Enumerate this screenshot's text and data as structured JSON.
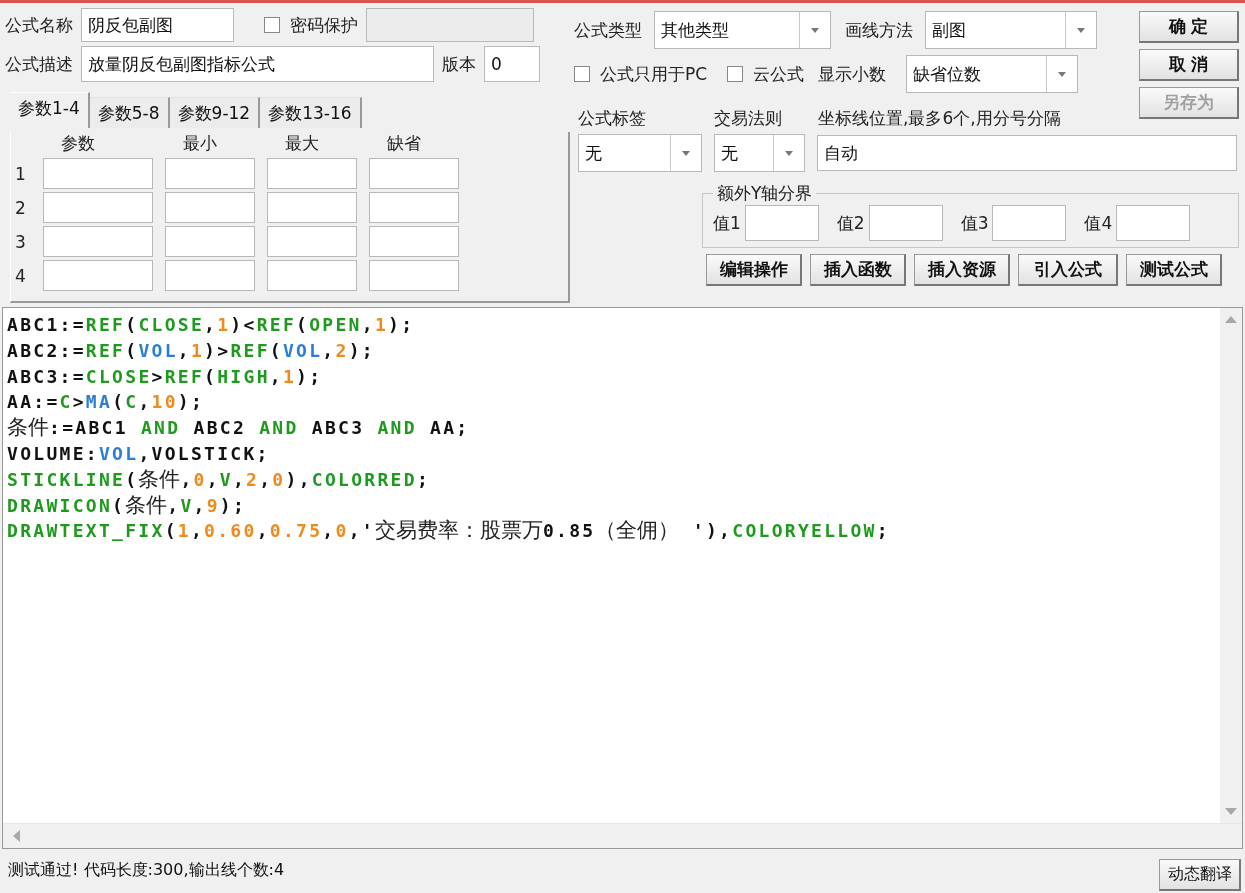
{
  "name_field": {
    "label": "公式名称",
    "value": "阴反包副图"
  },
  "password": {
    "label": "密码保护",
    "checked": false
  },
  "desc_field": {
    "label": "公式描述",
    "value": "放量阴反包副图指标公式"
  },
  "version_field": {
    "label": "版本",
    "value": "0"
  },
  "param_tabs": [
    {
      "label": "参数1-4",
      "selected": true
    },
    {
      "label": "参数5-8",
      "selected": false
    },
    {
      "label": "参数9-12",
      "selected": false
    },
    {
      "label": "参数13-16",
      "selected": false
    }
  ],
  "param_columns": [
    "参数",
    "最小",
    "最大",
    "缺省"
  ],
  "param_rows": [
    "1",
    "2",
    "3",
    "4"
  ],
  "formula_type": {
    "label": "公式类型",
    "value": "其他类型"
  },
  "draw_method": {
    "label": "画线方法",
    "value": "副图"
  },
  "options": [
    {
      "label": "公式只用于PC",
      "checked": false
    },
    {
      "label": "云公式",
      "checked": false
    }
  ],
  "decimals": {
    "label": "显示小数",
    "value": "缺省位数"
  },
  "formula_tag": {
    "label": "公式标签",
    "value": "无"
  },
  "trade_rule": {
    "label": "交易法则",
    "value": "无"
  },
  "axis_lines": {
    "label": "坐标线位置,最多6个,用分号分隔",
    "value": "自动"
  },
  "y_bounds": {
    "title": "额外Y轴分界",
    "fields": [
      "值1",
      "值2",
      "值3",
      "值4"
    ]
  },
  "side_buttons": [
    {
      "label": "确 定",
      "disabled": false
    },
    {
      "label": "取 消",
      "disabled": false
    },
    {
      "label": "另存为",
      "disabled": true
    }
  ],
  "tool_buttons": [
    "编辑操作",
    "插入函数",
    "插入资源",
    "引入公式",
    "测试公式"
  ],
  "code_lines": [
    [
      {
        "kind": "text",
        "text": "ABC1:="
      },
      {
        "kind": "func",
        "text": "REF"
      },
      {
        "kind": "text",
        "text": "("
      },
      {
        "kind": "func",
        "text": "CLOSE"
      },
      {
        "kind": "text",
        "text": ","
      },
      {
        "kind": "num",
        "text": "1"
      },
      {
        "kind": "text",
        "text": ")<"
      },
      {
        "kind": "func",
        "text": "REF"
      },
      {
        "kind": "text",
        "text": "("
      },
      {
        "kind": "func",
        "text": "OPEN"
      },
      {
        "kind": "text",
        "text": ","
      },
      {
        "kind": "num",
        "text": "1"
      },
      {
        "kind": "text",
        "text": ");"
      }
    ],
    [
      {
        "kind": "text",
        "text": "ABC2:="
      },
      {
        "kind": "func",
        "text": "REF"
      },
      {
        "kind": "text",
        "text": "("
      },
      {
        "kind": "var",
        "text": "VOL"
      },
      {
        "kind": "text",
        "text": ","
      },
      {
        "kind": "num",
        "text": "1"
      },
      {
        "kind": "text",
        "text": ")>"
      },
      {
        "kind": "func",
        "text": "REF"
      },
      {
        "kind": "text",
        "text": "("
      },
      {
        "kind": "var",
        "text": "VOL"
      },
      {
        "kind": "text",
        "text": ","
      },
      {
        "kind": "num",
        "text": "2"
      },
      {
        "kind": "text",
        "text": ");"
      }
    ],
    [
      {
        "kind": "text",
        "text": "ABC3:="
      },
      {
        "kind": "func",
        "text": "CLOSE"
      },
      {
        "kind": "text",
        "text": ">"
      },
      {
        "kind": "func",
        "text": "REF"
      },
      {
        "kind": "text",
        "text": "("
      },
      {
        "kind": "func",
        "text": "HIGH"
      },
      {
        "kind": "text",
        "text": ","
      },
      {
        "kind": "num",
        "text": "1"
      },
      {
        "kind": "text",
        "text": ");"
      }
    ],
    [
      {
        "kind": "text",
        "text": "AA:="
      },
      {
        "kind": "func",
        "text": "C"
      },
      {
        "kind": "text",
        "text": ">"
      },
      {
        "kind": "var",
        "text": "MA"
      },
      {
        "kind": "text",
        "text": "("
      },
      {
        "kind": "func",
        "text": "C"
      },
      {
        "kind": "text",
        "text": ","
      },
      {
        "kind": "num",
        "text": "10"
      },
      {
        "kind": "text",
        "text": ");"
      }
    ],
    [
      {
        "kind": "cjk",
        "text": "条件"
      },
      {
        "kind": "text",
        "text": ":=ABC1 "
      },
      {
        "kind": "func",
        "text": "AND"
      },
      {
        "kind": "text",
        "text": " ABC2 "
      },
      {
        "kind": "func",
        "text": "AND"
      },
      {
        "kind": "text",
        "text": " ABC3 "
      },
      {
        "kind": "func",
        "text": "AND"
      },
      {
        "kind": "text",
        "text": " AA;"
      }
    ],
    [
      {
        "kind": "text",
        "text": "VOLUME:"
      },
      {
        "kind": "var",
        "text": "VOL"
      },
      {
        "kind": "text",
        "text": ",VOLSTICK;"
      }
    ],
    [
      {
        "kind": "func",
        "text": "STICKLINE"
      },
      {
        "kind": "text",
        "text": "("
      },
      {
        "kind": "cjk",
        "text": "条件"
      },
      {
        "kind": "text",
        "text": ","
      },
      {
        "kind": "num",
        "text": "0"
      },
      {
        "kind": "text",
        "text": ","
      },
      {
        "kind": "func",
        "text": "V"
      },
      {
        "kind": "text",
        "text": ","
      },
      {
        "kind": "num",
        "text": "2"
      },
      {
        "kind": "text",
        "text": ","
      },
      {
        "kind": "num",
        "text": "0"
      },
      {
        "kind": "text",
        "text": "),"
      },
      {
        "kind": "func",
        "text": "COLORRED"
      },
      {
        "kind": "text",
        "text": ";"
      }
    ],
    [
      {
        "kind": "func",
        "text": "DRAWICON"
      },
      {
        "kind": "text",
        "text": "("
      },
      {
        "kind": "cjk",
        "text": "条件"
      },
      {
        "kind": "text",
        "text": ","
      },
      {
        "kind": "func",
        "text": "V"
      },
      {
        "kind": "text",
        "text": ","
      },
      {
        "kind": "num",
        "text": "9"
      },
      {
        "kind": "text",
        "text": ");"
      }
    ],
    [
      {
        "kind": "func",
        "text": "DRAWTEXT_FIX"
      },
      {
        "kind": "text",
        "text": "("
      },
      {
        "kind": "num",
        "text": "1"
      },
      {
        "kind": "text",
        "text": ","
      },
      {
        "kind": "num",
        "text": "0.60"
      },
      {
        "kind": "text",
        "text": ","
      },
      {
        "kind": "num",
        "text": "0.75"
      },
      {
        "kind": "text",
        "text": ","
      },
      {
        "kind": "num",
        "text": "0"
      },
      {
        "kind": "text",
        "text": ",'"
      },
      {
        "kind": "cjk",
        "text": "交易费率：股票万"
      },
      {
        "kind": "text",
        "text": "0.85"
      },
      {
        "kind": "cjk",
        "text": "（全佣）  "
      },
      {
        "kind": "text",
        "text": "'),"
      },
      {
        "kind": "func",
        "text": "COLORYELLOW"
      },
      {
        "kind": "text",
        "text": ";"
      }
    ]
  ],
  "status": {
    "text": "测试通过! 代码长度:300,输出线个数:4",
    "button": "动态翻译"
  }
}
